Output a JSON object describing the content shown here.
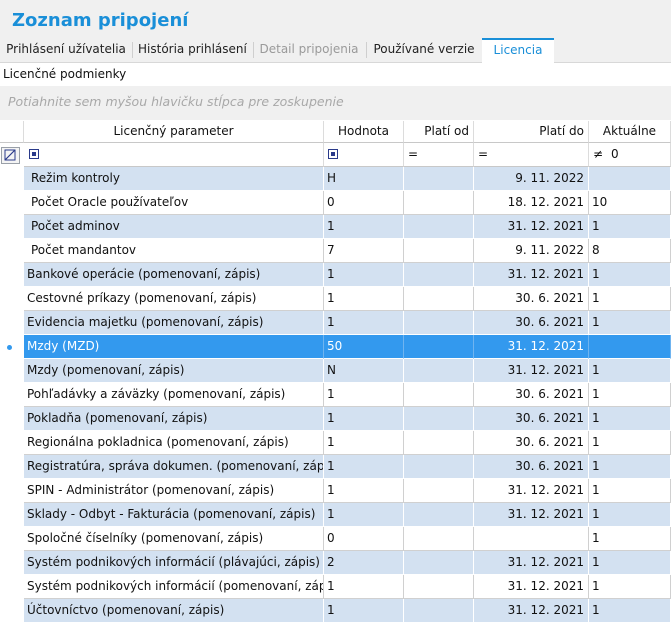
{
  "window": {
    "title": "Zoznam pripojení"
  },
  "tabs": [
    {
      "label": "Prihlásení užívatelia",
      "state": "normal"
    },
    {
      "label": "História prihlásení",
      "state": "normal"
    },
    {
      "label": "Detail pripojenia",
      "state": "disabled"
    },
    {
      "label": "Používané verzie",
      "state": "normal"
    },
    {
      "label": "Licencia",
      "state": "active"
    }
  ],
  "section": {
    "label": "Licenčné podmienky"
  },
  "grouping": {
    "hint": "Potiahnite sem myšou hlavičku stĺpca pre zoskupenie"
  },
  "table": {
    "columns": [
      "Licenčný parameter",
      "Hodnota",
      "Platí od",
      "Platí do",
      "Aktuálne"
    ],
    "filter": {
      "plati_od_op": "=",
      "plati_do_op": "=",
      "aktualne_op": "≠",
      "aktualne_value": "0"
    },
    "rows": [
      {
        "param": "Režim kontroly",
        "hodnota": "H",
        "od": "",
        "do": "9. 11. 2022",
        "akt": ""
      },
      {
        "param": "Počet Oracle používateľov",
        "hodnota": "0",
        "od": "",
        "do": "18. 12. 2021",
        "akt": "10"
      },
      {
        "param": "Počet adminov",
        "hodnota": "1",
        "od": "",
        "do": "31. 12. 2021",
        "akt": "1"
      },
      {
        "param": "Počet mandantov",
        "hodnota": "7",
        "od": "",
        "do": "9. 11. 2022",
        "akt": "8"
      },
      {
        "param": "Bankové operácie (pomenovaní, zápis)",
        "hodnota": "1",
        "od": "",
        "do": "31. 12. 2021",
        "akt": "1"
      },
      {
        "param": "Cestovné príkazy (pomenovaní, zápis)",
        "hodnota": "1",
        "od": "",
        "do": "30. 6. 2021",
        "akt": "1"
      },
      {
        "param": "Evidencia majetku (pomenovaní, zápis)",
        "hodnota": "1",
        "od": "",
        "do": "30. 6. 2021",
        "akt": "1"
      },
      {
        "param": "Mzdy  (MZD)",
        "hodnota": "50",
        "od": "",
        "do": "31. 12. 2021",
        "akt": ""
      },
      {
        "param": "Mzdy (pomenovaní, zápis)",
        "hodnota": "N",
        "od": "",
        "do": "31. 12. 2021",
        "akt": "1"
      },
      {
        "param": "Pohľadávky a záväzky (pomenovaní, zápis)",
        "hodnota": "1",
        "od": "",
        "do": "30. 6. 2021",
        "akt": "1"
      },
      {
        "param": "Pokladňa (pomenovaní, zápis)",
        "hodnota": "1",
        "od": "",
        "do": "30. 6. 2021",
        "akt": "1"
      },
      {
        "param": "Regionálna pokladnica (pomenovaní, zápis)",
        "hodnota": "1",
        "od": "",
        "do": "30. 6. 2021",
        "akt": "1"
      },
      {
        "param": "Registratúra, správa dokumen. (pomenovaní, zápis)",
        "hodnota": "1",
        "od": "",
        "do": "30. 6. 2021",
        "akt": "1"
      },
      {
        "param": "SPIN - Administrátor (pomenovaní, zápis)",
        "hodnota": "1",
        "od": "",
        "do": "31. 12. 2021",
        "akt": "1"
      },
      {
        "param": "Sklady - Odbyt - Fakturácia (pomenovaní, zápis)",
        "hodnota": "1",
        "od": "",
        "do": "31. 12. 2021",
        "akt": "1"
      },
      {
        "param": "Spoločné číselníky (pomenovaní, zápis)",
        "hodnota": "0",
        "od": "",
        "do": "",
        "akt": "1"
      },
      {
        "param": "Systém podnikových informácií (plávajúci, zápis)",
        "hodnota": "2",
        "od": "",
        "do": "31. 12. 2021",
        "akt": "1"
      },
      {
        "param": "Systém podnikových informácií (pomenovaní, zápis)",
        "hodnota": "1",
        "od": "",
        "do": "31. 12. 2021",
        "akt": "1"
      },
      {
        "param": "Účtovníctvo (pomenovaní, zápis)",
        "hodnota": "1",
        "od": "",
        "do": "31. 12. 2021",
        "akt": "1"
      }
    ],
    "selected_row": 7
  },
  "colors": {
    "accent": "#1a8fd8",
    "selection": "#3399ee",
    "row_alt": "#d3e1f1"
  }
}
